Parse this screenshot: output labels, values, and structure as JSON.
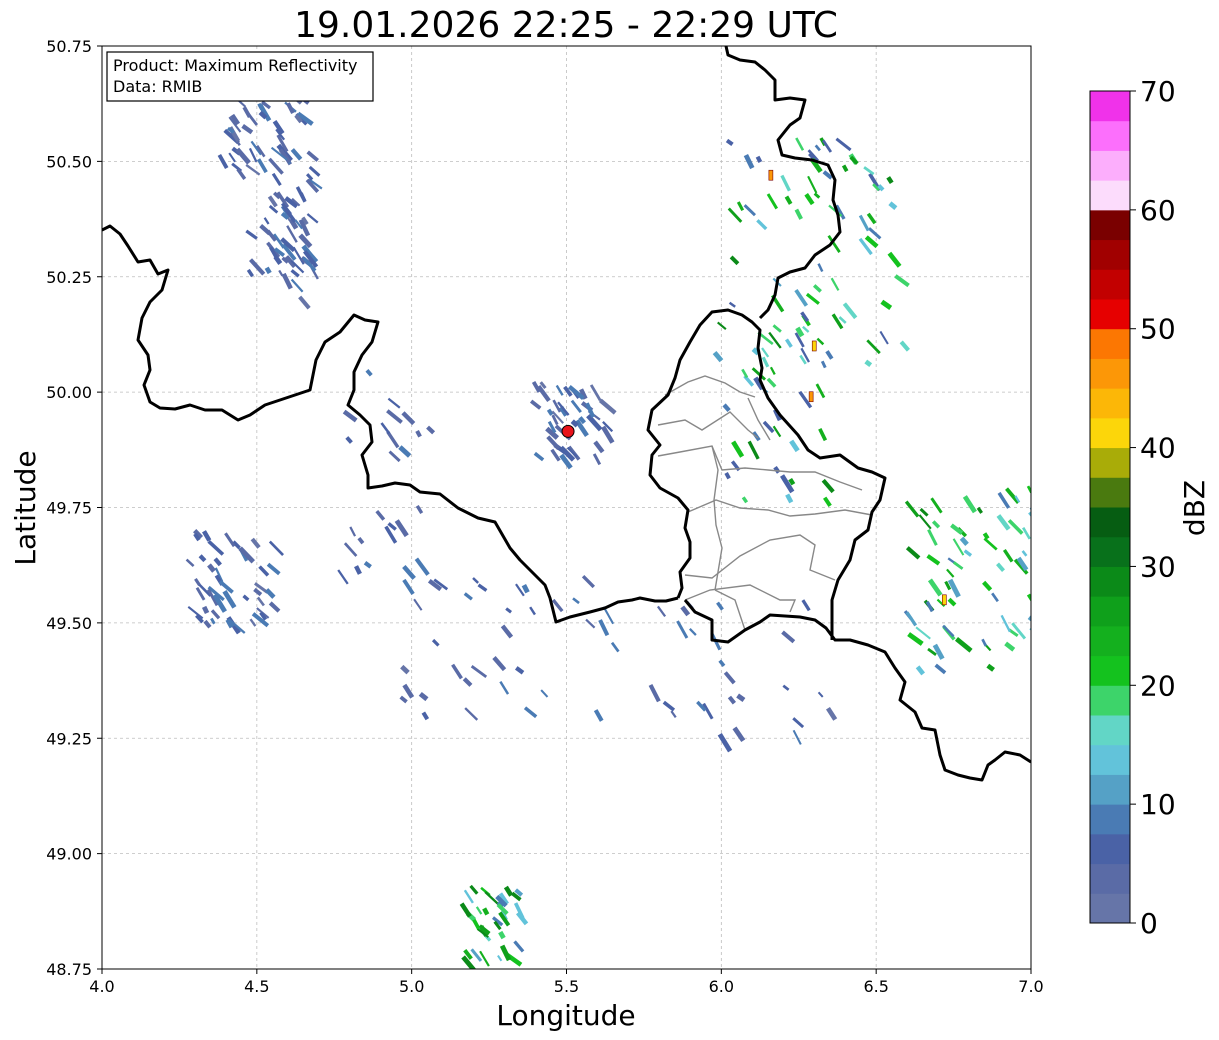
{
  "title": "19.01.2026 22:25 - 22:29 UTC",
  "info_box": {
    "product": "Product: Maximum Reflectivity",
    "source": "Data: RMIB"
  },
  "axes": {
    "xlabel": "Longitude",
    "ylabel": "Latitude",
    "xlim": [
      4.0,
      7.0
    ],
    "ylim": [
      48.75,
      50.75
    ],
    "xticks": [
      4.0,
      4.5,
      5.0,
      5.5,
      6.0,
      6.5,
      7.0
    ],
    "xtick_labels": [
      "4.0",
      "4.5",
      "5.0",
      "5.5",
      "6.0",
      "6.5",
      "7.0"
    ],
    "yticks": [
      48.75,
      49.0,
      49.25,
      49.5,
      49.75,
      50.0,
      50.25,
      50.5,
      50.75
    ],
    "ytick_labels": [
      "48.75",
      "49.00",
      "49.25",
      "49.50",
      "49.75",
      "50.00",
      "50.25",
      "50.50",
      "50.75"
    ],
    "grid": true
  },
  "radar_site": {
    "lon": 5.505,
    "lat": 49.915,
    "color": "#e8131b"
  },
  "colorbar": {
    "label": "dBZ",
    "min": 0,
    "max": 70,
    "step": 2.5,
    "tick_values": [
      0,
      10,
      20,
      30,
      40,
      50,
      60,
      70
    ],
    "tick_labels": [
      "0",
      "10",
      "20",
      "30",
      "40",
      "50",
      "60",
      "70"
    ],
    "colors": [
      "#6675a8",
      "#5a6ba6",
      "#4a62a6",
      "#4a7bb4",
      "#55a1c6",
      "#62c3da",
      "#62d6c6",
      "#3dd46a",
      "#14c21e",
      "#14b01e",
      "#0fa01b",
      "#0b8a18",
      "#08711b",
      "#065d12",
      "#4a7a0f",
      "#a9ac08",
      "#fcd60a",
      "#fcb707",
      "#fc9707",
      "#fc7702",
      "#e60000",
      "#c20000",
      "#a10000",
      "#7a0000",
      "#fcdcfc",
      "#fcaefc",
      "#fc6ffc",
      "#f032ea"
    ]
  },
  "echo_clusters": [
    {
      "lon": 4.5,
      "lat": 50.6,
      "dx": 0.14,
      "dy": 0.12,
      "n": 60,
      "level": 1
    },
    {
      "lon": 4.6,
      "lat": 50.4,
      "dx": 0.08,
      "dy": 0.14,
      "n": 40,
      "level": 1
    },
    {
      "lon": 4.55,
      "lat": 50.28,
      "dx": 0.1,
      "dy": 0.08,
      "n": 20,
      "level": 1
    },
    {
      "lon": 4.4,
      "lat": 49.6,
      "dx": 0.14,
      "dy": 0.1,
      "n": 45,
      "level": 1
    },
    {
      "lon": 5.25,
      "lat": 48.85,
      "dx": 0.1,
      "dy": 0.08,
      "n": 35,
      "level": 3
    },
    {
      "lon": 5.5,
      "lat": 49.94,
      "dx": 0.12,
      "dy": 0.08,
      "n": 40,
      "level": 1
    },
    {
      "lon": 6.3,
      "lat": 50.3,
      "dx": 0.3,
      "dy": 0.25,
      "n": 70,
      "level": 2
    },
    {
      "lon": 6.15,
      "lat": 49.95,
      "dx": 0.18,
      "dy": 0.2,
      "n": 35,
      "level": 2
    },
    {
      "lon": 6.8,
      "lat": 49.6,
      "dx": 0.22,
      "dy": 0.2,
      "n": 70,
      "level": 3
    },
    {
      "lon": 5.3,
      "lat": 49.45,
      "dx": 0.35,
      "dy": 0.15,
      "n": 35,
      "level": 1
    },
    {
      "lon": 6.0,
      "lat": 49.4,
      "dx": 0.4,
      "dy": 0.15,
      "n": 25,
      "level": 1
    },
    {
      "lon": 4.9,
      "lat": 49.8,
      "dx": 0.15,
      "dy": 0.25,
      "n": 25,
      "level": 1
    }
  ],
  "strong_cells": [
    {
      "lon": 6.29,
      "lat": 49.99,
      "value": 47
    },
    {
      "lon": 6.3,
      "lat": 50.1,
      "value": 42
    },
    {
      "lon": 6.16,
      "lat": 50.47,
      "value": 45
    },
    {
      "lon": 6.72,
      "lat": 49.55,
      "value": 40
    }
  ]
}
